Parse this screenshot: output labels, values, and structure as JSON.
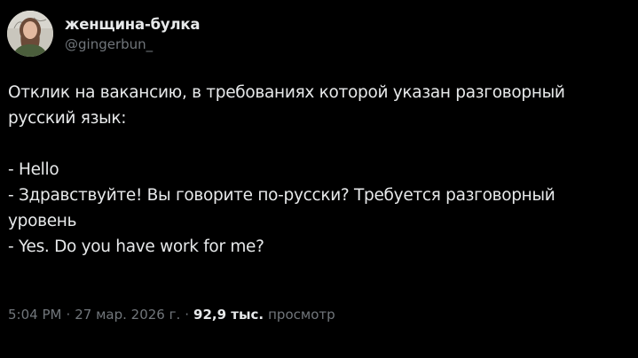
{
  "author": {
    "display_name": "женщина-булка",
    "handle": "@gingerbun_",
    "avatar": "profile-photo"
  },
  "tweet": {
    "lines": [
      "Отклик на вакансию, в требованиях которой указан разговорный",
      "русский язык:",
      "",
      "- Hello",
      "- Здравствуйте! Вы говорите по-русски? Требуется разговорный",
      "уровень",
      "- Yes. Do you have work for me?"
    ]
  },
  "meta": {
    "time": "5:04 PM",
    "separator": "·",
    "date": "27 мар. 2026 г.",
    "views_count": "92,9 тыс.",
    "views_label": "просмотр"
  },
  "colors": {
    "background": "#000000",
    "primary_text": "#e7e9ea",
    "secondary_text": "#71767b"
  }
}
